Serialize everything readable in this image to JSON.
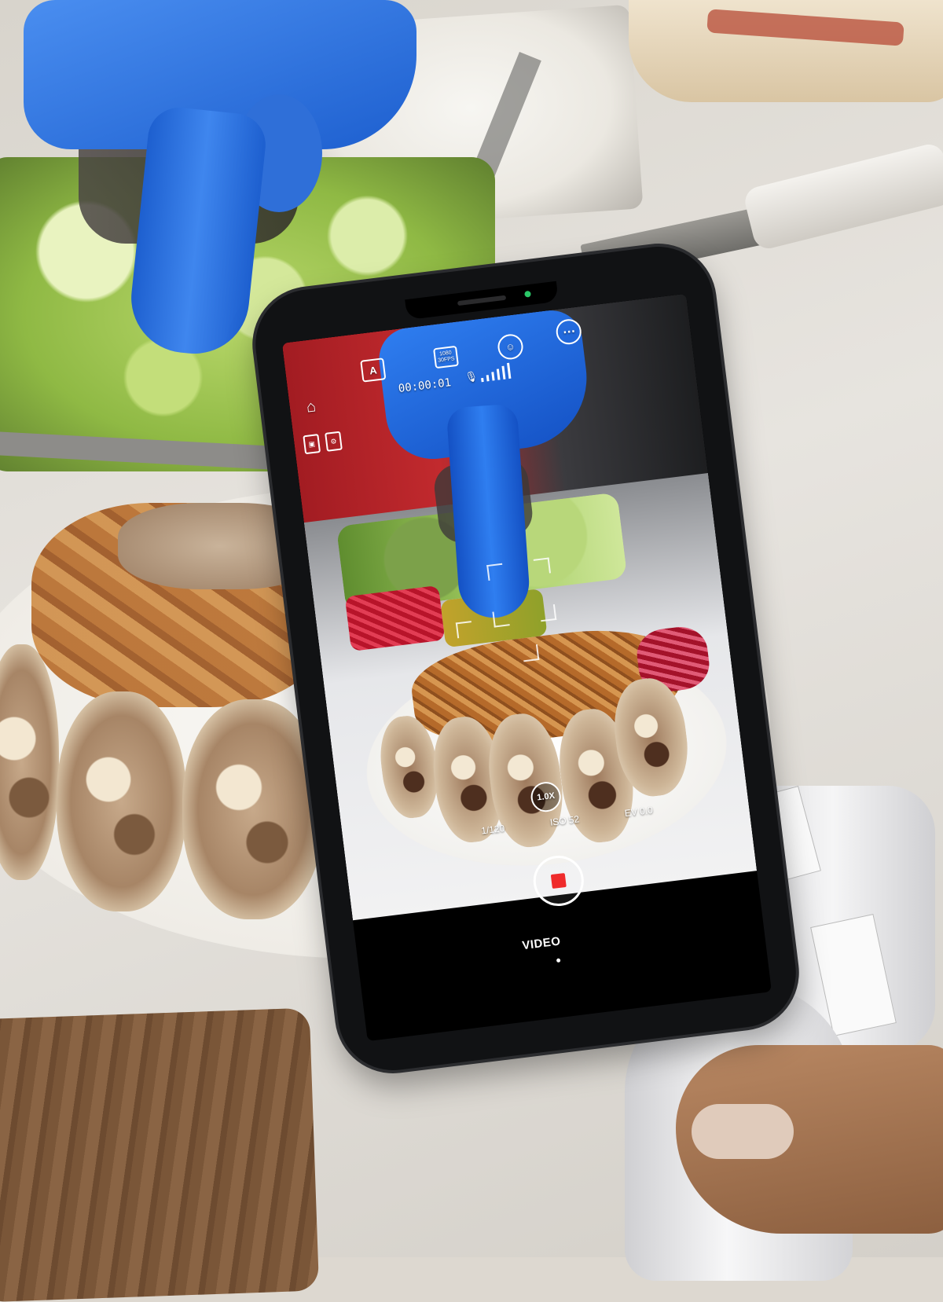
{
  "camera_app": {
    "timer": "00:00:01",
    "zoom": "1.0X",
    "shutter": "1/120",
    "iso": "ISO 52",
    "ev": "EV 0.0",
    "mode": "VIDEO",
    "auto_label": "A",
    "resolution_label": "1080 30FPS",
    "mic_level_bars": 6,
    "recording": true
  },
  "colors": {
    "record_red": "#ef2b2b",
    "glove_blue": "#1d5fcf",
    "phone_black": "#111214",
    "gimbal_white": "#f5f5f6"
  },
  "icons": [
    "home-icon",
    "auto-mode-icon",
    "resolution-icon",
    "face-track-icon",
    "more-options-icon",
    "microphone-icon",
    "record-icon"
  ]
}
